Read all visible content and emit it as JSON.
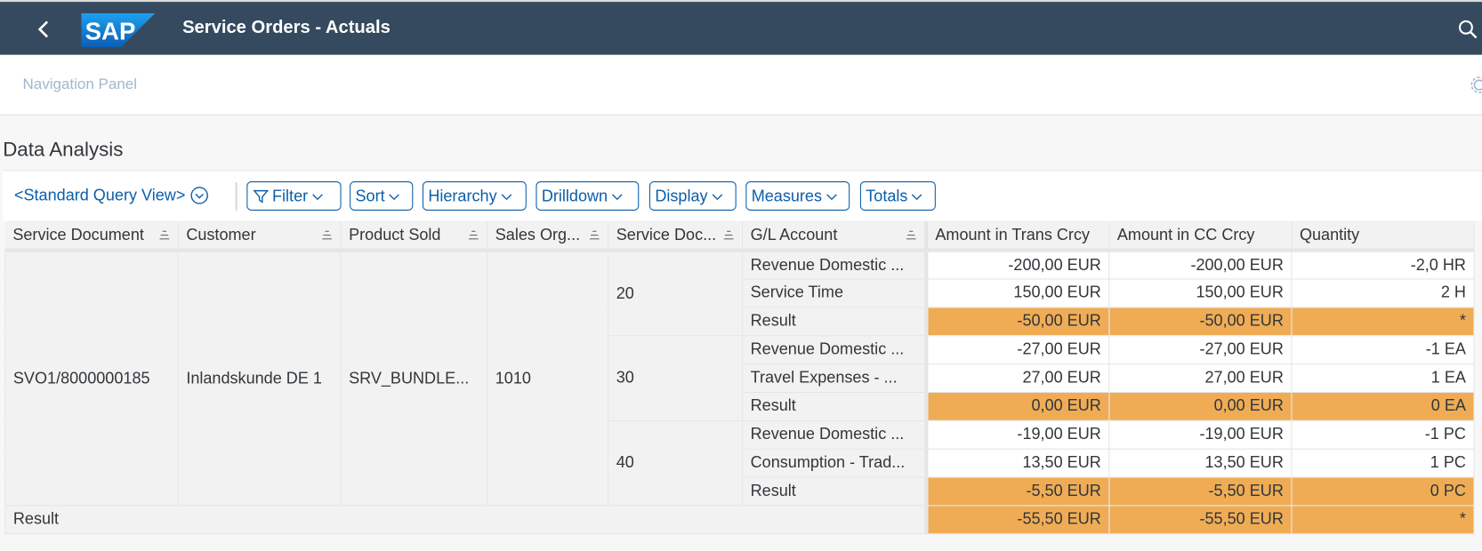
{
  "shell": {
    "title": "Service Orders - Actuals",
    "logo_text": "SAP",
    "back_icon": "chevron-left-icon",
    "search_icon": "search-icon"
  },
  "nav": {
    "label": "Navigation Panel",
    "settings_icon": "gear-icon"
  },
  "section": {
    "title": "Data Analysis"
  },
  "toolbar": {
    "query_view": "<Standard Query View>",
    "buttons": [
      {
        "label": "Filter",
        "icon": "filter-icon"
      },
      {
        "label": "Sort"
      },
      {
        "label": "Hierarchy"
      },
      {
        "label": "Drilldown"
      },
      {
        "label": "Display"
      },
      {
        "label": "Measures"
      },
      {
        "label": "Totals"
      }
    ]
  },
  "table": {
    "headers": [
      "Service Document",
      "Customer",
      "Product Sold",
      "Sales Org...",
      "Service Doc...",
      "G/L Account",
      "Amount in Trans Crcy",
      "Amount in CC Crcy",
      "Quantity"
    ],
    "service_document": "SVO1/8000000185",
    "customer": "Inlandskunde DE 1",
    "product_sold": "SRV_BUNDLE...",
    "sales_org": "1010",
    "groups": [
      {
        "item": "20",
        "rows": [
          {
            "gl": "Revenue Domestic ...",
            "trans": "-200,00 EUR",
            "cc": "-200,00 EUR",
            "qty": "-2,0 HR"
          },
          {
            "gl": "Service Time",
            "trans": "150,00 EUR",
            "cc": "150,00 EUR",
            "qty": "2 H"
          },
          {
            "gl": "Result",
            "trans": "-50,00 EUR",
            "cc": "-50,00 EUR",
            "qty": "*"
          }
        ]
      },
      {
        "item": "30",
        "rows": [
          {
            "gl": "Revenue Domestic ...",
            "trans": "-27,00 EUR",
            "cc": "-27,00 EUR",
            "qty": "-1 EA"
          },
          {
            "gl": "Travel Expenses - ...",
            "trans": "27,00 EUR",
            "cc": "27,00 EUR",
            "qty": "1 EA"
          },
          {
            "gl": "Result",
            "trans": "0,00 EUR",
            "cc": "0,00 EUR",
            "qty": "0 EA"
          }
        ]
      },
      {
        "item": "40",
        "rows": [
          {
            "gl": "Revenue Domestic ...",
            "trans": "-19,00 EUR",
            "cc": "-19,00 EUR",
            "qty": "-1 PC"
          },
          {
            "gl": "Consumption - Trad...",
            "trans": "13,50 EUR",
            "cc": "13,50 EUR",
            "qty": "1 PC"
          },
          {
            "gl": "Result",
            "trans": "-5,50 EUR",
            "cc": "-5,50 EUR",
            "qty": "0 PC"
          }
        ]
      }
    ],
    "total": {
      "label": "Result",
      "trans": "-55,50 EUR",
      "cc": "-55,50 EUR",
      "qty": "*"
    }
  },
  "colors": {
    "shell_bg": "#354a5f",
    "accent": "#0b5ea9",
    "result_highlight": "#efac55"
  }
}
